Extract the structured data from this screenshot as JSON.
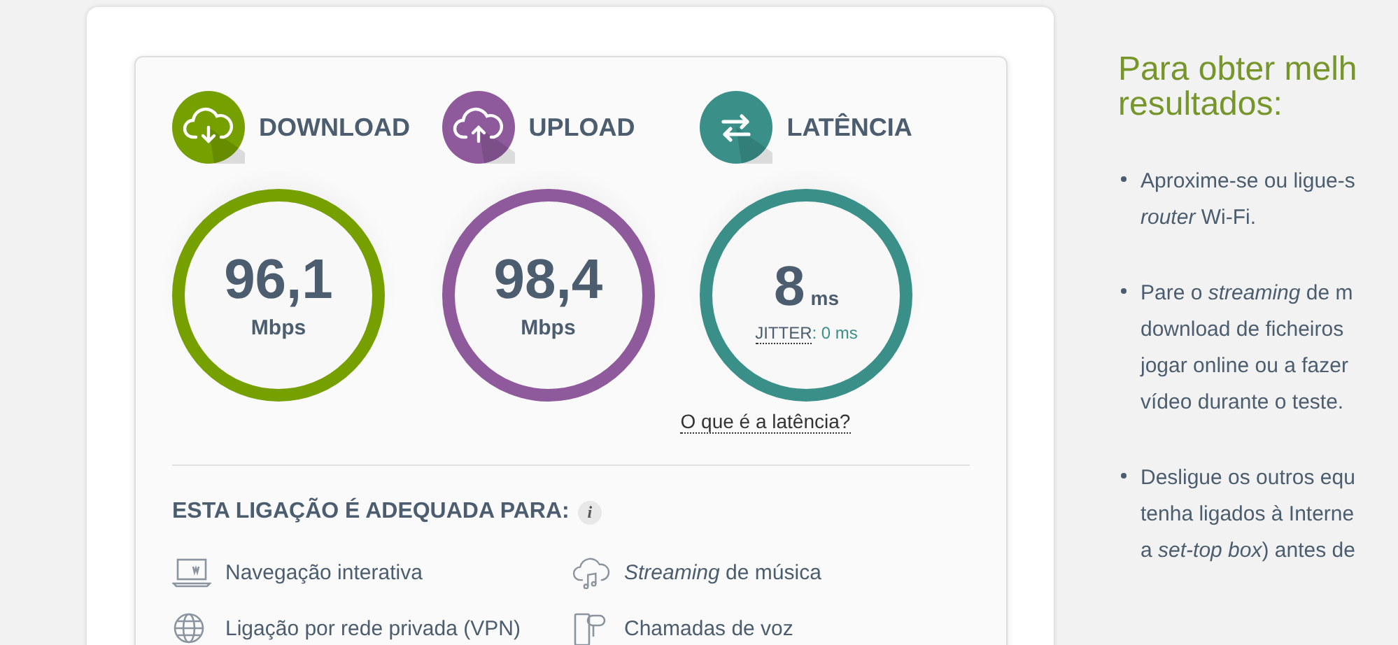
{
  "metrics": [
    {
      "kind": "download",
      "label": "DOWNLOAD",
      "value": "96,1",
      "unit": "Mbps",
      "color": "#76a000"
    },
    {
      "kind": "upload",
      "label": "UPLOAD",
      "value": "98,4",
      "unit": "Mbps",
      "color": "#8e5a9c"
    },
    {
      "kind": "latency",
      "label": "LATÊNCIA",
      "value": "8",
      "unit": "ms",
      "color": "#3a9089",
      "jitter_label": "JITTER",
      "jitter_text": ": 0 ms",
      "link": "O que é a latência?"
    }
  ],
  "suitability": {
    "heading": "ESTA LIGAÇÃO É ADEQUADA PARA:",
    "info": "i",
    "items": [
      {
        "kind": "browsing",
        "text": "Navegação interativa"
      },
      {
        "kind": "music",
        "text": "*Streaming* de música"
      },
      {
        "kind": "vpn",
        "text": "Ligação por rede privada (VPN)"
      },
      {
        "kind": "voice",
        "text": "Chamadas de voz"
      }
    ]
  },
  "tips": {
    "title": [
      "Para obter melh",
      "resultados:"
    ],
    "items": [
      [
        "Aproxime-se ou ligue-s",
        "*router* Wi-Fi."
      ],
      [
        "Pare o *streaming* de m",
        "download de ficheiros",
        "jogar online ou a fazer",
        "vídeo durante o teste."
      ],
      [
        "Desligue os outros equ",
        "tenha ligados à Interne",
        "a *set-top box*) antes de"
      ]
    ]
  }
}
